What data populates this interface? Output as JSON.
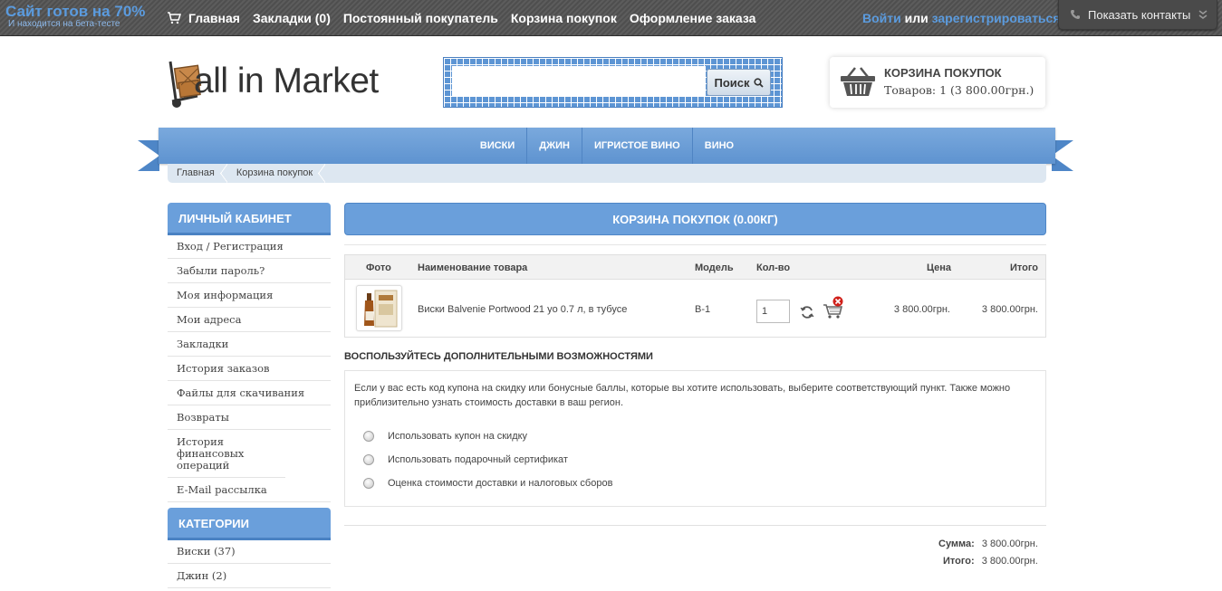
{
  "topbar": {
    "beta_main": "Сайт готов на 70%",
    "beta_sub": "И находится на бета-тесте",
    "nav": [
      "Главная",
      "Закладки (0)",
      "Постоянный покупатель",
      "Корзина покупок",
      "Оформление заказа"
    ],
    "login": "Войти",
    "or": " или ",
    "register": "зарегистрироваться",
    "contacts": "Показать контакты"
  },
  "header": {
    "logo_text": "all in Market",
    "search_button": "Поиск",
    "search_placeholder": "",
    "cart_title": "КОРЗИНА ПОКУПОК",
    "cart_summary": "Товаров: 1 (3 800.00грн.)"
  },
  "menu": [
    "ВИСКИ",
    "ДЖИН",
    "ИГРИСТОЕ ВИНО",
    "ВИНО"
  ],
  "breadcrumb": [
    "Главная",
    "Корзина покупок"
  ],
  "account": {
    "title": "ЛИЧНЫЙ КАБИНЕТ",
    "items": [
      "Вход / Регистрация",
      "Забыли пароль?",
      "Моя информация",
      "Мои адреса",
      "Закладки",
      "История заказов",
      "Файлы для скачивания",
      "Возвраты",
      "История финансовых операций",
      "E-Mail рассылка"
    ]
  },
  "categories": {
    "title": "КАТЕГОРИИ",
    "items": [
      "Виски (37)",
      "Джин (2)"
    ]
  },
  "cart": {
    "title": "КОРЗИНА ПОКУПОК  (0.00КГ)",
    "headers": {
      "photo": "Фото",
      "name": "Наименование товара",
      "model": "Модель",
      "qty": "Кол-во",
      "price": "Цена",
      "total": "Итого"
    },
    "rows": [
      {
        "name": "Виски Balvenie Portwood 21 yo 0.7 л, в тубусе",
        "model": "B-1",
        "qty": "1",
        "price": "3 800.00грн.",
        "total": "3 800.00грн."
      }
    ]
  },
  "extras": {
    "title": "ВОСПОЛЬЗУЙТЕСЬ ДОПОЛНИТЕЛЬНЫМИ ВОЗМОЖНОСТЯМИ",
    "description": "Если у вас есть код купона на скидку или бонусные баллы, которые вы хотите использовать, выберите соответствующий пункт. Также можно приблизительно узнать стоимость доставки в ваш регион.",
    "options": [
      "Использовать купон на скидку",
      "Использовать подарочный сертификат",
      "Оценка стоимости доставки и налоговых сборов"
    ]
  },
  "totals": {
    "sum_label": "Сумма:",
    "sum_value": "3 800.00грн.",
    "total_label": "Итого:",
    "total_value": "3 800.00грн."
  },
  "colors": {
    "accent": "#6a9fdb",
    "topbar": "#555555",
    "link": "#5b9bde"
  }
}
